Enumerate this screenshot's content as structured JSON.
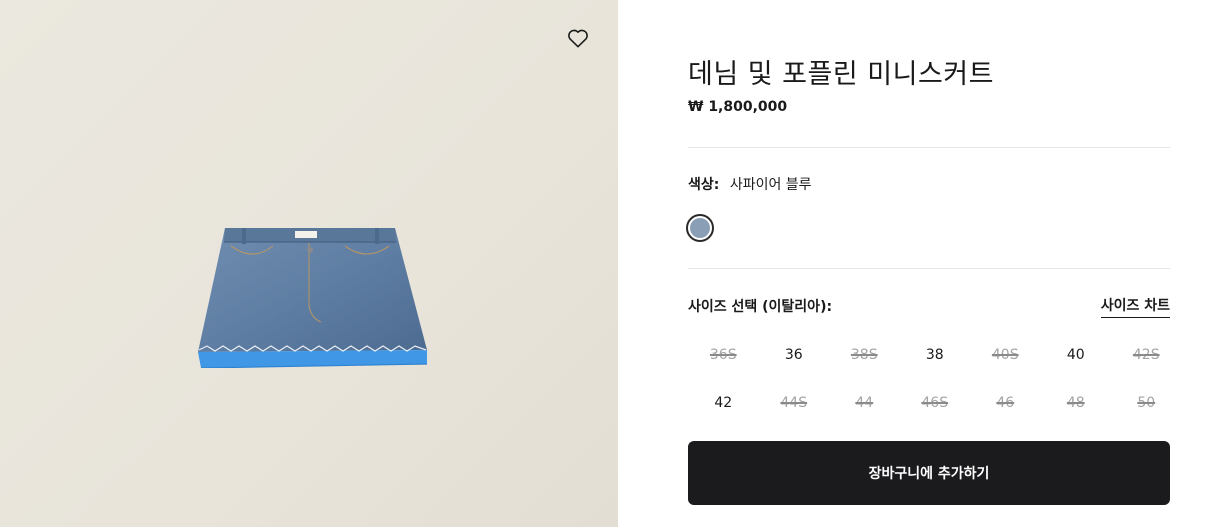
{
  "product": {
    "title": "데님 및 포플린 미니스커트",
    "price": "₩ 1,800,000",
    "image_icon": "denim-skirt-image",
    "wishlist_icon": "heart-outline-icon"
  },
  "color": {
    "label": "색상:",
    "value": "사파이어 블루",
    "swatch_color": "#8a9eb6"
  },
  "size": {
    "title": "사이즈 선택 (이탈리아):",
    "chart_link": "사이즈 차트",
    "options": [
      {
        "label": "36S",
        "available": false
      },
      {
        "label": "36",
        "available": true
      },
      {
        "label": "38S",
        "available": false
      },
      {
        "label": "38",
        "available": true
      },
      {
        "label": "40S",
        "available": false
      },
      {
        "label": "40",
        "available": true
      },
      {
        "label": "42S",
        "available": false
      },
      {
        "label": "42",
        "available": true
      },
      {
        "label": "44S",
        "available": false
      },
      {
        "label": "44",
        "available": false
      },
      {
        "label": "46S",
        "available": false
      },
      {
        "label": "46",
        "available": false
      },
      {
        "label": "48",
        "available": false
      },
      {
        "label": "50",
        "available": false
      }
    ]
  },
  "cart": {
    "button_label": "장바구니에 추가하기"
  }
}
